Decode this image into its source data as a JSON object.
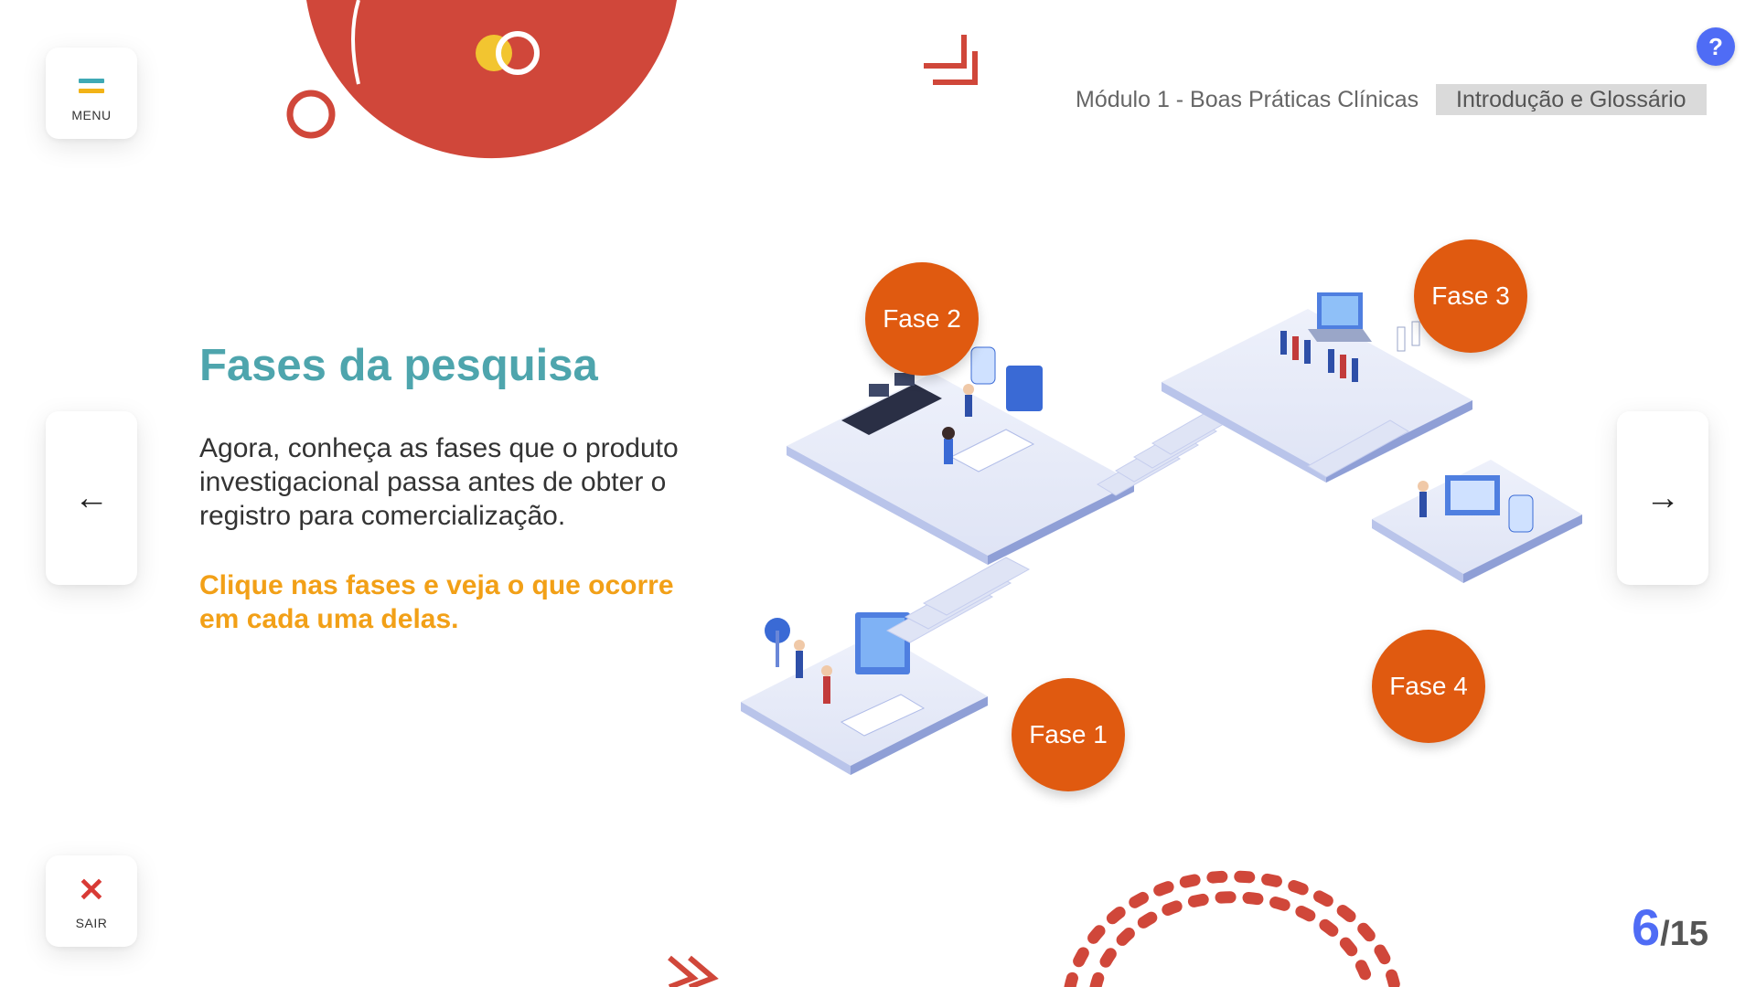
{
  "menu": {
    "label": "MENU"
  },
  "exit": {
    "label": "SAIR"
  },
  "help": {
    "label": "?"
  },
  "breadcrumb": {
    "module": "Módulo 1 - Boas Práticas Clínicas",
    "section": "Introdução e Glossário"
  },
  "nav": {
    "prev_icon": "arrow-left-icon",
    "next_icon": "arrow-right-icon"
  },
  "content": {
    "title": "Fases da pesquisa",
    "body": "Agora, conheça as fases que o produto investigacional passa antes de obter o registro para comercialização.",
    "cta": "Clique nas fases e veja o que ocorre em cada uma delas."
  },
  "phases": [
    "Fase 1",
    "Fase 2",
    "Fase 3",
    "Fase 4"
  ],
  "pager": {
    "current": "6",
    "total": "/15"
  },
  "colors": {
    "accent_teal": "#4ea5ad",
    "accent_orange": "#e05a10",
    "cta_yellow": "#f2a017",
    "decor_red": "#d0473a",
    "pager_blue": "#4f6cf5"
  }
}
